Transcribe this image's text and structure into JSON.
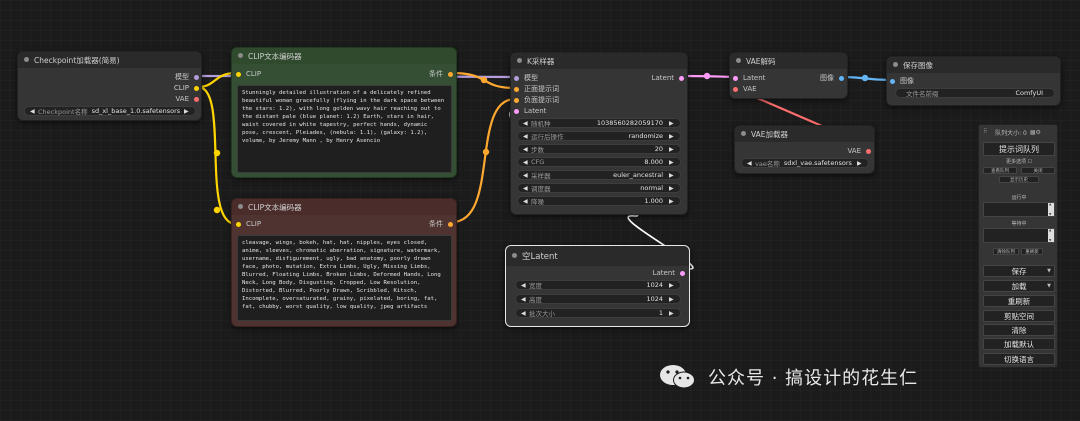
{
  "nodes": {
    "checkpoint": {
      "title": "Checkpoint加载器(简易)",
      "outputs": [
        "模型",
        "CLIP",
        "VAE"
      ],
      "widget_label": "Checkpoint名称",
      "widget_value": "sd_xl_base_1.0.safetensors"
    },
    "clip_pos": {
      "title": "CLIP文本编码器",
      "input": "CLIP",
      "output": "条件",
      "text": "Stunningly detailed illustration of a delicately refined beautiful woman gracefully (flying in the dark space between the stars: 1.2), with long golden wavy hair reaching out to the distant pale (blue planet: 1.2) Earth, stars in hair, waist covered in white tapestry, perfect hands, dynamic pose, crescent, Pleiades, (nebula: 1.1), (galaxy: 1.2), volume, by Jeremy Mann , by Henry Asencio"
    },
    "clip_neg": {
      "title": "CLIP文本编码器",
      "input": "CLIP",
      "output": "条件",
      "text": "cleavage, wings, bokeh, hat, hat, nipples, eyes closed, anime, sleeves, chromatic aberration, signature, watermark, username, disfigurement, ugly, bad anatomy, poorly drawn face, photo, mutation, Extra Limbs, Ugly, Missing Limbs, Blurred, Floating Limbs, Broken Limbs, Deformed Hands, Long Neck, Long Body, Disgusting, Cropped, Low Resolution, Distorted, Blurred, Poorly Drawn, Scribbled, Kitsch, Incomplete, oversaturated, grainy, pixelated, boring, fat, fat, chubby, worst quality, low quality, jpeg artifacts"
    },
    "ksampler": {
      "title": "K采样器",
      "inputs": [
        "模型",
        "正面提示词",
        "负面提示词",
        "Latent"
      ],
      "output": "Latent",
      "widgets": [
        {
          "label": "随机种",
          "value": "1038560282059170"
        },
        {
          "label": "运行后操作",
          "value": "randomize"
        },
        {
          "label": "步数",
          "value": "20"
        },
        {
          "label": "CFG",
          "value": "8.000"
        },
        {
          "label": "采样器",
          "value": "euler_ancestral"
        },
        {
          "label": "调度器",
          "value": "normal"
        },
        {
          "label": "降噪",
          "value": "1.000"
        }
      ]
    },
    "latent": {
      "title": "空Latent",
      "output": "Latent",
      "widgets": [
        {
          "label": "宽度",
          "value": "1024"
        },
        {
          "label": "高度",
          "value": "1024"
        },
        {
          "label": "批次大小",
          "value": "1"
        }
      ]
    },
    "vae_decode": {
      "title": "VAE解码",
      "inputs": [
        "Latent",
        "VAE"
      ],
      "output": "图像"
    },
    "save": {
      "title": "保存图像",
      "input": "图像",
      "widget_label": "文件名前缀",
      "widget_value": "ComfyUI"
    },
    "vae_loader": {
      "title": "VAE加载器",
      "output": "VAE",
      "widget_label": "vae名称",
      "widget_value": "sdxl_vae.safetensors"
    }
  },
  "panel": {
    "queue_size": "队列大小: 0",
    "queue_prompt": "提示词队列",
    "extra_options": "更多选项",
    "view_queue": "查看队列",
    "view_history": "显示历史",
    "close": "关闭",
    "running": "运行中",
    "pending": "等待中",
    "clear_queue": "清除队列",
    "refresh": "重刷新",
    "save": "保存",
    "load": "加载",
    "refresh2": "重刷新",
    "clipspace": "剪贴空间",
    "clear": "清除",
    "load_default": "加载默认",
    "switch_lang": "切换语言"
  },
  "watermark": "公众号 · 搞设计的花生仁",
  "colors": {
    "model": "#b39ddb",
    "clip": "#ffd500",
    "vae": "#ff6e6e",
    "conditioning": "#ffa931",
    "latent": "#ff9cf9",
    "image": "#64b5f6"
  }
}
